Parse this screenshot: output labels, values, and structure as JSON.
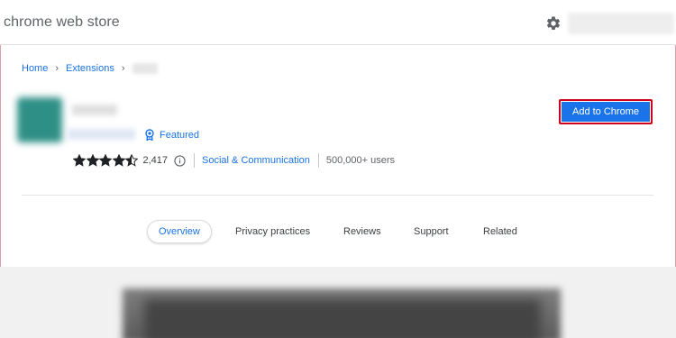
{
  "header": {
    "title": "chrome web store",
    "settings_icon": "gear-icon"
  },
  "breadcrumb": {
    "home": "Home",
    "extensions": "Extensions"
  },
  "extension": {
    "featured_label": "Featured",
    "rating": 4.5,
    "rating_count": "2,417",
    "category": "Social & Communication",
    "users": "500,000+ users",
    "add_button": "Add to Chrome"
  },
  "tabs": [
    {
      "label": "Overview",
      "active": true
    },
    {
      "label": "Privacy practices",
      "active": false
    },
    {
      "label": "Reviews",
      "active": false
    },
    {
      "label": "Support",
      "active": false
    },
    {
      "label": "Related",
      "active": false
    }
  ],
  "colors": {
    "accent": "#1a73e8",
    "highlight_border": "#d0021b",
    "star": "#202124"
  }
}
